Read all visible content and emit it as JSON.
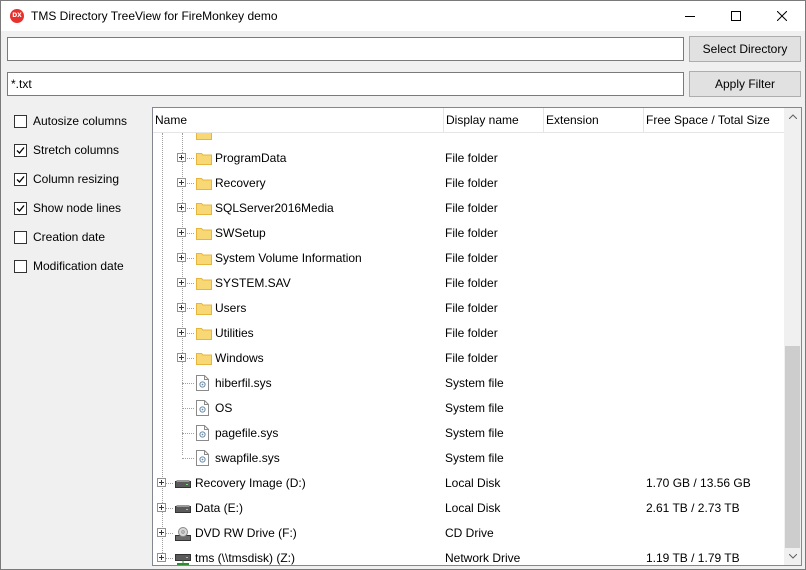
{
  "window": {
    "title": "TMS Directory TreeView for FireMonkey demo",
    "app_icon_text": "DX"
  },
  "controls": {
    "directory_value": "",
    "select_directory_label": "Select Directory",
    "filter_value": "*.txt",
    "apply_filter_label": "Apply Filter"
  },
  "options": [
    {
      "label": "Autosize columns",
      "checked": false
    },
    {
      "label": "Stretch columns",
      "checked": true
    },
    {
      "label": "Column resizing",
      "checked": true
    },
    {
      "label": "Show node lines",
      "checked": true
    },
    {
      "label": "Creation date",
      "checked": false
    },
    {
      "label": "Modification date",
      "checked": false
    }
  ],
  "tree": {
    "columns": [
      "Name",
      "Display name",
      "Extension",
      "Free Space / Total Size"
    ],
    "rows": [
      {
        "name": "ProgramData",
        "display": "File folder",
        "extension": "",
        "space": "",
        "icon": "folder-icon",
        "level": 1,
        "expandable": true
      },
      {
        "name": "Recovery",
        "display": "File folder",
        "extension": "",
        "space": "",
        "icon": "folder-icon",
        "level": 1,
        "expandable": true
      },
      {
        "name": "SQLServer2016Media",
        "display": "File folder",
        "extension": "",
        "space": "",
        "icon": "folder-icon",
        "level": 1,
        "expandable": true
      },
      {
        "name": "SWSetup",
        "display": "File folder",
        "extension": "",
        "space": "",
        "icon": "folder-icon",
        "level": 1,
        "expandable": true
      },
      {
        "name": "System Volume Information",
        "display": "File folder",
        "extension": "",
        "space": "",
        "icon": "folder-icon",
        "level": 1,
        "expandable": true
      },
      {
        "name": "SYSTEM.SAV",
        "display": "File folder",
        "extension": "",
        "space": "",
        "icon": "folder-icon",
        "level": 1,
        "expandable": true
      },
      {
        "name": "Users",
        "display": "File folder",
        "extension": "",
        "space": "",
        "icon": "folder-icon",
        "level": 1,
        "expandable": true
      },
      {
        "name": "Utilities",
        "display": "File folder",
        "extension": "",
        "space": "",
        "icon": "folder-icon",
        "level": 1,
        "expandable": true
      },
      {
        "name": "Windows",
        "display": "File folder",
        "extension": "",
        "space": "",
        "icon": "folder-icon",
        "level": 1,
        "expandable": true
      },
      {
        "name": "hiberfil.sys",
        "display": "System file",
        "extension": "",
        "space": "",
        "icon": "system-file-icon",
        "level": 1,
        "expandable": false
      },
      {
        "name": "OS",
        "display": "System file",
        "extension": "",
        "space": "",
        "icon": "system-file-icon",
        "level": 1,
        "expandable": false
      },
      {
        "name": "pagefile.sys",
        "display": "System file",
        "extension": "",
        "space": "",
        "icon": "system-file-icon",
        "level": 1,
        "expandable": false
      },
      {
        "name": "swapfile.sys",
        "display": "System file",
        "extension": "",
        "space": "",
        "icon": "system-file-icon",
        "level": 1,
        "expandable": false
      },
      {
        "name": "Recovery Image (D:)",
        "display": "Local Disk",
        "extension": "",
        "space": "1.70 GB / 13.56 GB",
        "icon": "hard-drive-icon",
        "level": 0,
        "expandable": true
      },
      {
        "name": "Data (E:)",
        "display": "Local Disk",
        "extension": "",
        "space": "2.61 TB / 2.73 TB",
        "icon": "hard-drive-icon",
        "level": 0,
        "expandable": true
      },
      {
        "name": "DVD RW Drive (F:)",
        "display": "CD Drive",
        "extension": "",
        "space": "",
        "icon": "dvd-drive-icon",
        "level": 0,
        "expandable": true
      },
      {
        "name": "tms (\\\\tmsdisk) (Z:)",
        "display": "Network Drive",
        "extension": "",
        "space": "1.19 TB / 1.79 TB",
        "icon": "network-drive-icon",
        "level": 0,
        "expandable": true
      }
    ]
  },
  "colors": {
    "folder": "#f8d775",
    "folder_dark": "#e8b53c",
    "accent": "#e8312d"
  }
}
